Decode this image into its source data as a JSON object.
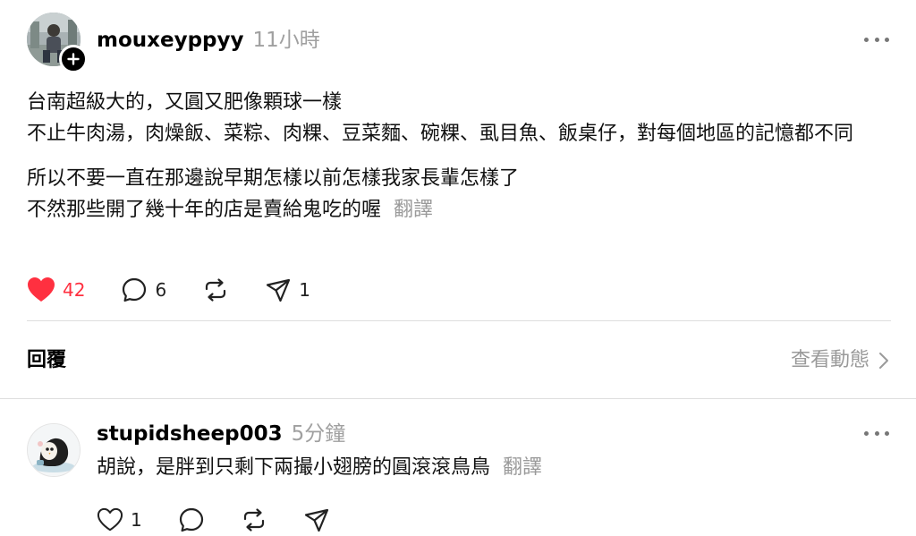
{
  "post": {
    "username": "mouxeyppyy",
    "time_ago": "11小時",
    "paragraphs": [
      "台南超級大的，又圓又肥像顆球一樣\n不止牛肉湯，肉燥飯、菜粽、肉粿、豆菜麵、碗粿、虱目魚、飯桌仔，對每個地區的記憶都不同",
      "所以不要一直在那邊說早期怎樣以前怎樣我家長輩怎樣了\n不然那些開了幾十年的店是賣給鬼吃的喔"
    ],
    "translate_label": "翻譯",
    "likes": "42",
    "liked": true,
    "comments": "6",
    "reposts": "",
    "shares": "1"
  },
  "replies_section": {
    "title": "回覆",
    "view_activity": "查看動態"
  },
  "reply": {
    "username": "stupidsheep003",
    "time_ago": "5分鐘",
    "text": "胡說，是胖到只剩下兩撮小翅膀的圓滾滾鳥鳥",
    "translate_label": "翻譯",
    "likes": "1"
  },
  "colors": {
    "like_active": "#ff3040",
    "muted_text": "#9a9a9a",
    "divider": "#dedede"
  },
  "icons": {
    "like": "heart-icon",
    "comment": "comment-bubble-icon",
    "repost": "repost-icon",
    "share": "send-icon",
    "more": "more-dots-icon",
    "follow": "plus-icon",
    "chevron": "chevron-right-icon"
  }
}
